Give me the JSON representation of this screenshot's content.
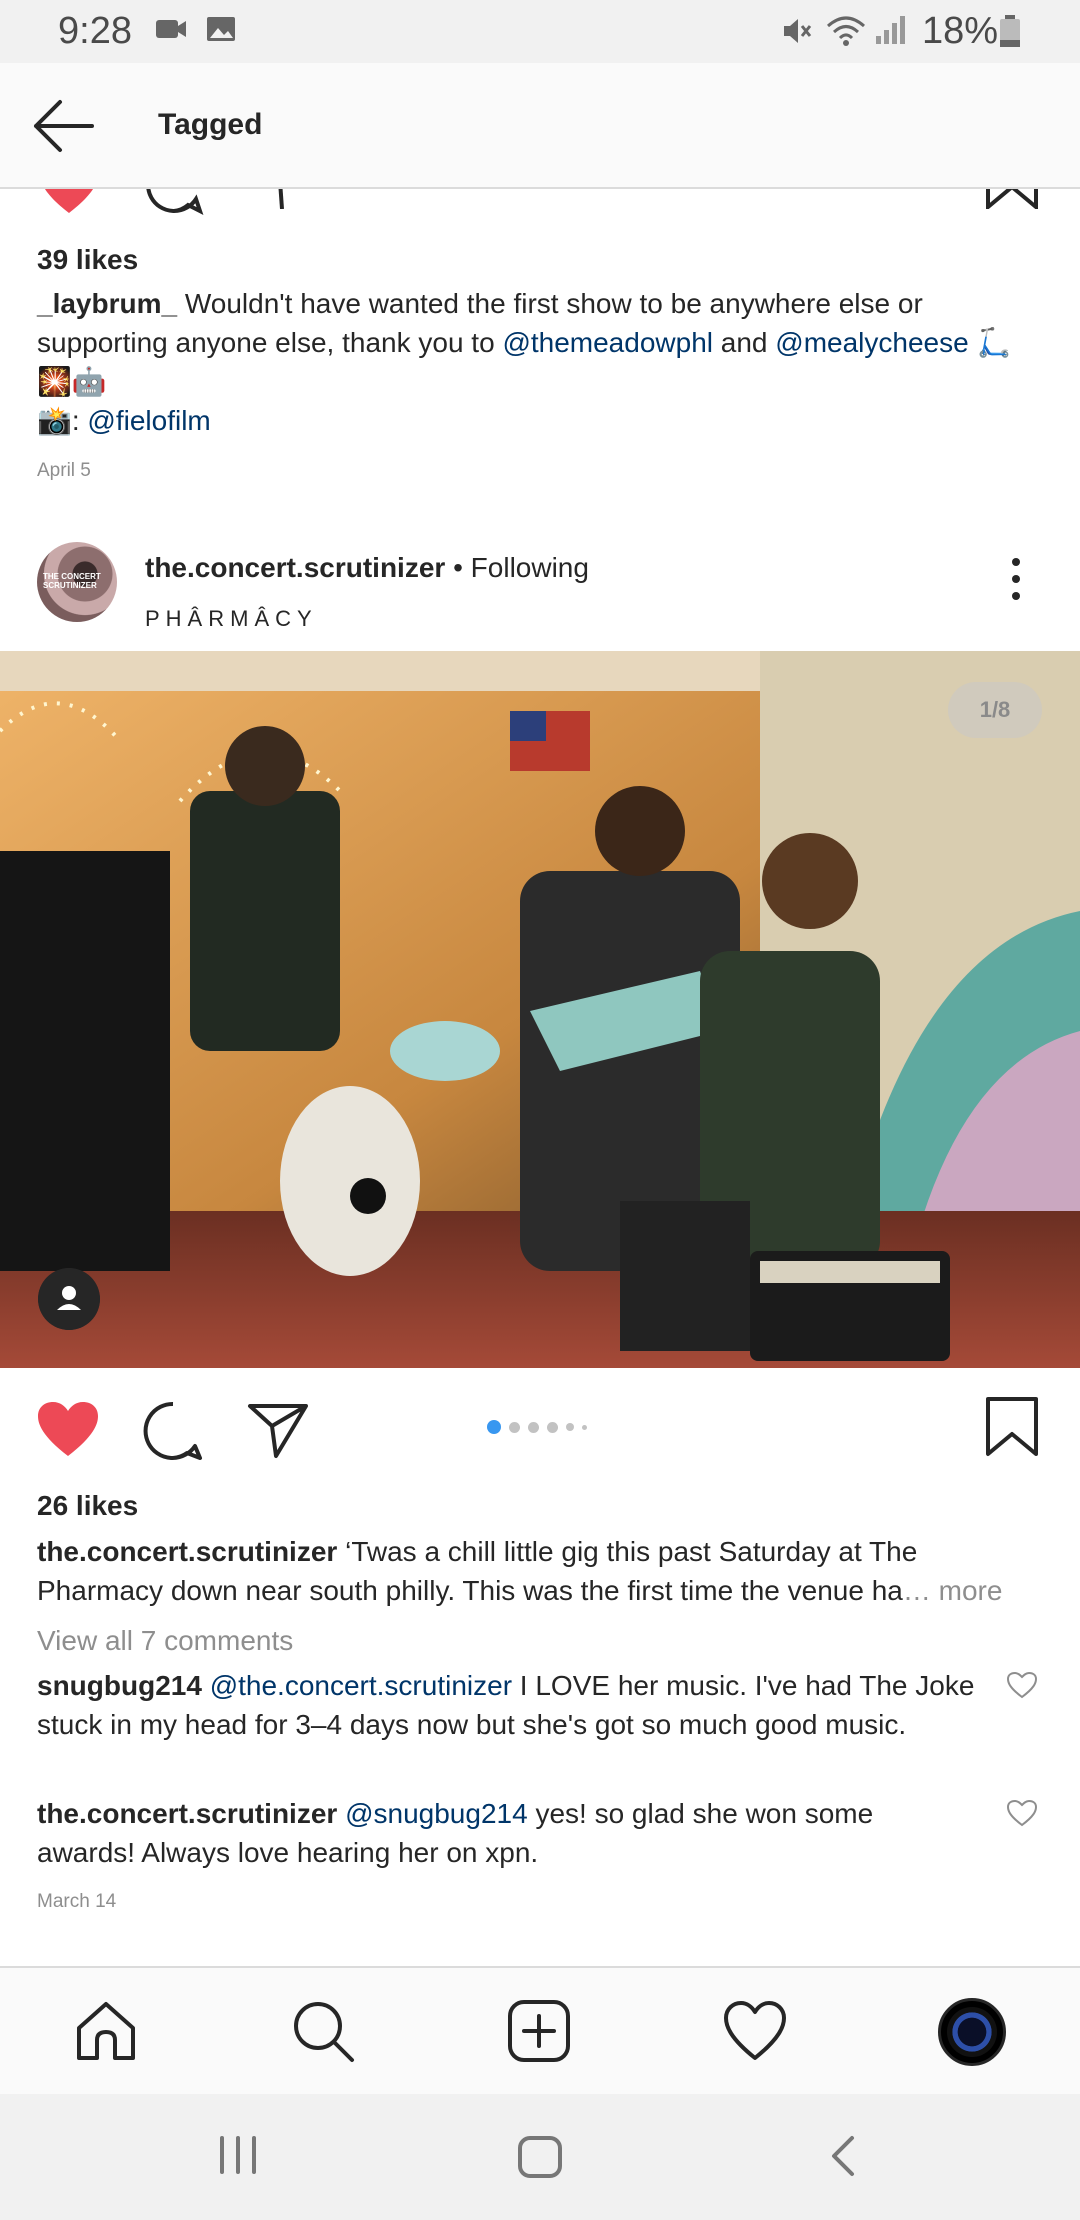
{
  "status_bar": {
    "time": "9:28",
    "battery": "18%",
    "icons": [
      "video-icon",
      "image-icon",
      "mute-icon",
      "wifi-icon",
      "signal-icon",
      "battery-icon"
    ]
  },
  "app_bar": {
    "title": "Tagged",
    "back_icon": "arrow-left-icon"
  },
  "previous_post": {
    "likes": "39 likes",
    "caption_user": "_laybrum_",
    "caption_text_1": " Wouldn't have wanted the first show to be anywhere else or supporting anyone else, thank you to ",
    "mention_1": "@themeadowphl",
    "caption_text_2": " and ",
    "mention_2": "@mealycheese",
    "emoji_line": "🛴 🎇🤖",
    "photo_credit_prefix": "📸: ",
    "photo_credit_mention": "@fielofilm",
    "date": "April 5"
  },
  "post": {
    "username": "the.concert.scrutinizer",
    "follow_status": " • Following",
    "location": "PHÂRMÂCY",
    "avatar_text": "THE CONCERT SCRUTINIZER",
    "photo_counter": "1/8",
    "likes": "26 likes",
    "caption_user": "the.concert.scrutinizer",
    "caption_text": " ‘Twas a chill little gig this past Saturday at The Pharmacy down near south philly. This was the first time the venue ha",
    "caption_more": "… more",
    "view_comments": "View all 7 comments",
    "comments": [
      {
        "user": "snugbug214",
        "mention": "@the.concert.scrutinizer",
        "text": " I LOVE her music. I've had The Joke stuck in my head for 3–4 days now but she's got so much good music."
      },
      {
        "user": "the.concert.scrutinizer",
        "mention": "@snugbug214",
        "text": " yes! so glad she won some awards! Always love hearing her on xpn."
      }
    ],
    "date": "March 14",
    "carousel": {
      "count": 6,
      "active": 1
    },
    "accent_like": "#ed4956",
    "accent_dot": "#3897f0"
  },
  "bottom_nav": {
    "items": [
      "home-icon",
      "search-icon",
      "add-post-icon",
      "activity-heart-icon",
      "profile-avatar"
    ]
  },
  "system_nav": {
    "items": [
      "recent-apps-icon",
      "home-button-icon",
      "back-chevron-icon"
    ]
  }
}
